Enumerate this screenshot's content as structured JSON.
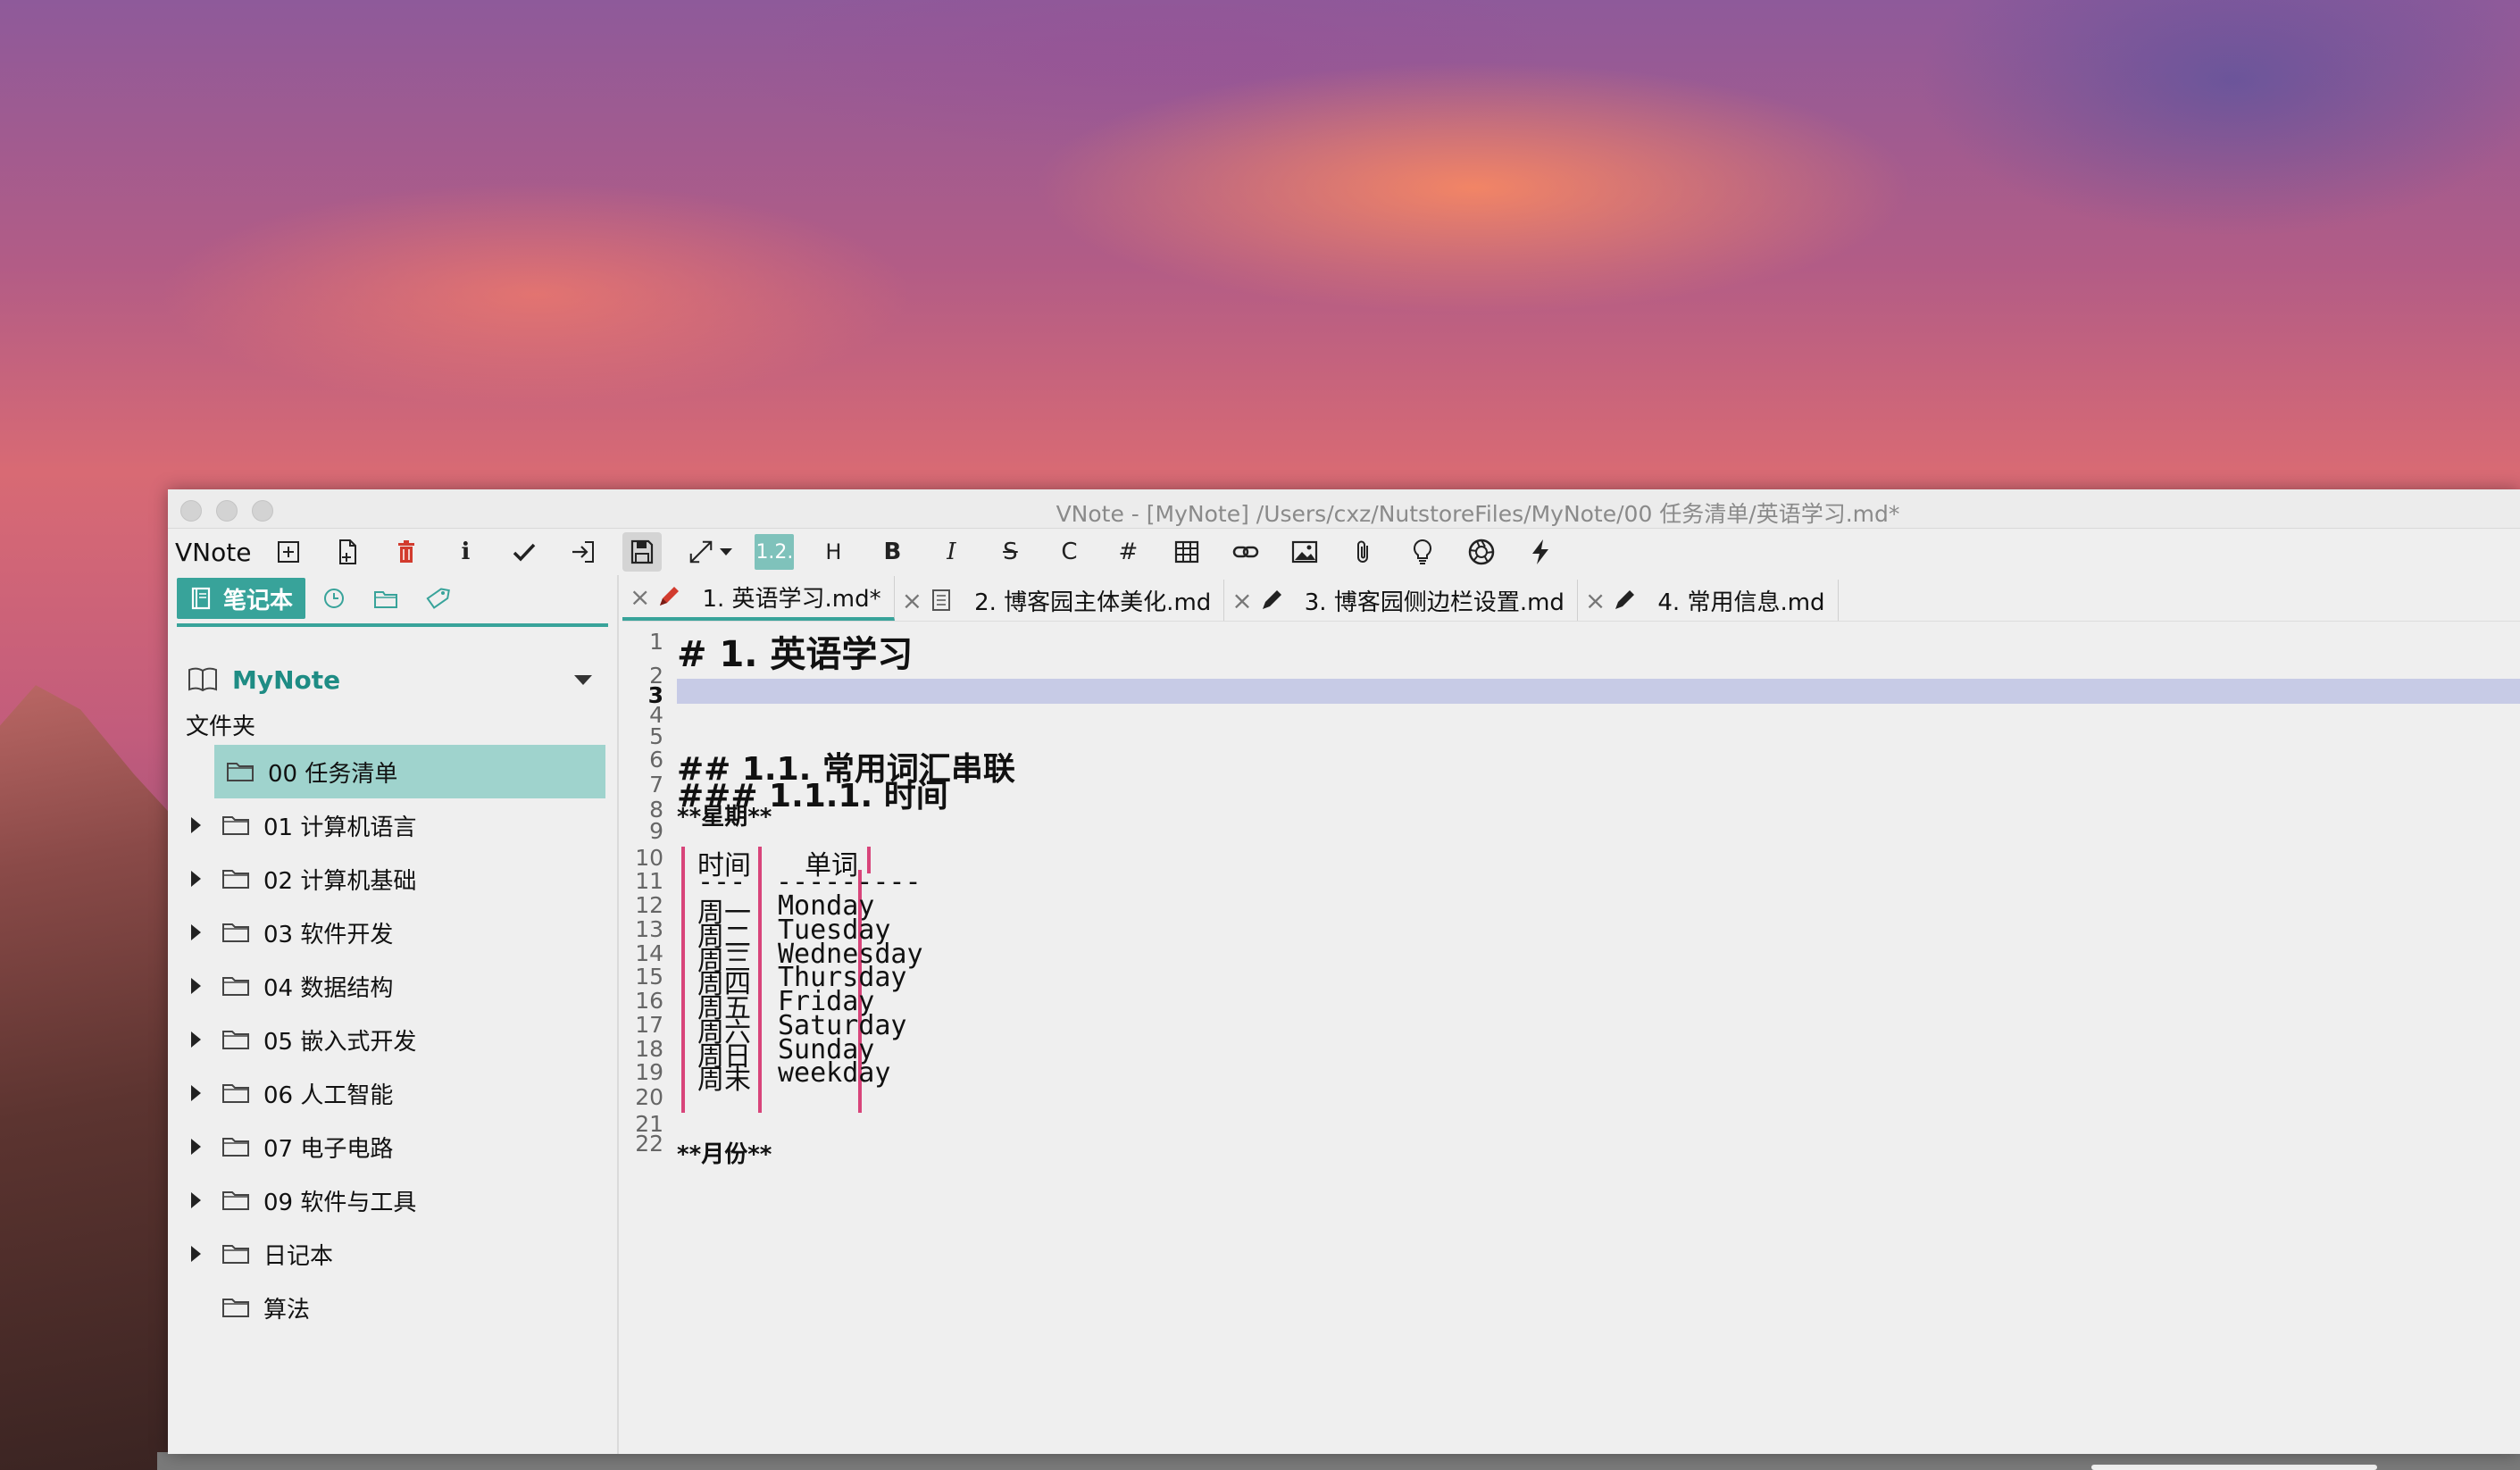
{
  "window": {
    "title": "VNote - [MyNote] /Users/cxz/NutstoreFiles/MyNote/00 任务清单/英语学习.md*"
  },
  "toolbar": {
    "app_name": "VNote",
    "heading_num": "1.2.",
    "heading_label": "H",
    "bold_label": "B",
    "italic_label": "I",
    "strike_label": "S",
    "code_label": "C",
    "hash_label": "#"
  },
  "sidebar": {
    "tab_notebook": "笔记本",
    "notebook_name": "MyNote",
    "folder_label": "文件夹",
    "folders": [
      {
        "name": "00 任务清单",
        "selected": true,
        "expandable": false
      },
      {
        "name": "01 计算机语言",
        "expandable": true
      },
      {
        "name": "02 计算机基础",
        "expandable": true
      },
      {
        "name": "03 软件开发",
        "expandable": true
      },
      {
        "name": "04 数据结构",
        "expandable": true
      },
      {
        "name": "05 嵌入式开发",
        "expandable": true
      },
      {
        "name": "06 人工智能",
        "expandable": true
      },
      {
        "name": "07 电子电路",
        "expandable": true
      },
      {
        "name": "09 软件与工具",
        "expandable": true
      },
      {
        "name": "日记本",
        "expandable": true
      },
      {
        "name": "算法",
        "expandable": false
      }
    ]
  },
  "tabs": [
    {
      "label": "1. 英语学习.md*",
      "active": true,
      "icon": "pencil-red-icon"
    },
    {
      "label": "2. 博客园主体美化.md",
      "active": false,
      "icon": "document-icon"
    },
    {
      "label": "3. 博客园侧边栏设置.md",
      "active": false,
      "icon": "pencil-icon"
    },
    {
      "label": "4. 常用信息.md",
      "active": false,
      "icon": "pencil-icon"
    }
  ],
  "editor": {
    "line_numbers": [
      "1",
      "2",
      "3",
      "4",
      "5",
      "6",
      "7",
      "8",
      "9",
      "10",
      "11",
      "12",
      "13",
      "14",
      "15",
      "16",
      "17",
      "18",
      "19",
      "20",
      "21",
      "22"
    ],
    "heading1": "# 1. 英语学习",
    "heading2": "## 1.1. 常用词汇串联",
    "heading3": "### 1.1.1. 时间",
    "bold_line": "**星期**",
    "last_line": "**月份**",
    "table": {
      "header": [
        "时间",
        "单词"
      ],
      "separator": [
        "---",
        "---------"
      ],
      "rows": [
        [
          "周一",
          "Monday"
        ],
        [
          "周二",
          "Tuesday"
        ],
        [
          "周三",
          "Wednesday"
        ],
        [
          "周四",
          "Thursday"
        ],
        [
          "周五",
          "Friday"
        ],
        [
          "周六",
          "Saturday"
        ],
        [
          "周日",
          "Sunday"
        ],
        [
          "周末",
          "weekday"
        ]
      ]
    }
  },
  "colors": {
    "accent": "#38a39a",
    "selected_folder": "#9fd3cd",
    "pipe": "#d8447a",
    "current_line": "#c7cbe6"
  }
}
